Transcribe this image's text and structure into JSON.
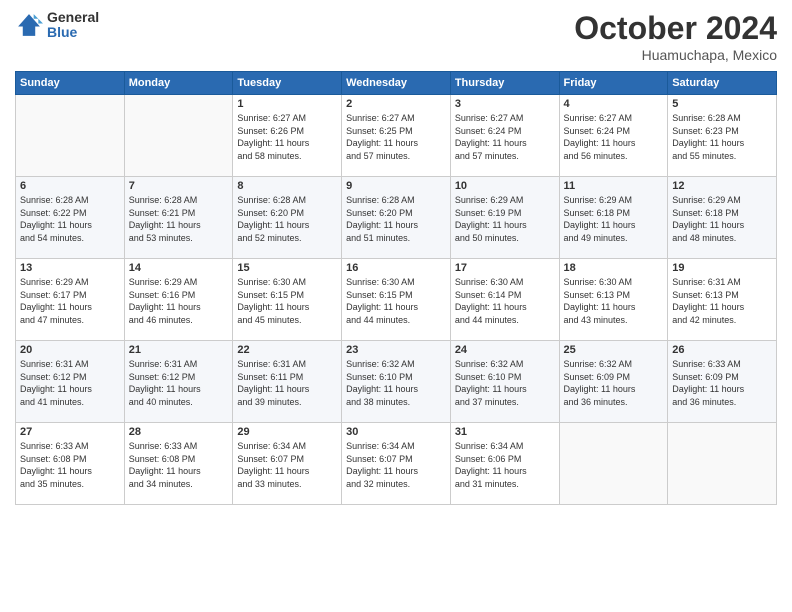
{
  "header": {
    "logo_general": "General",
    "logo_blue": "Blue",
    "month": "October 2024",
    "location": "Huamuchapa, Mexico"
  },
  "days_of_week": [
    "Sunday",
    "Monday",
    "Tuesday",
    "Wednesday",
    "Thursday",
    "Friday",
    "Saturday"
  ],
  "weeks": [
    [
      {
        "day": "",
        "info": ""
      },
      {
        "day": "",
        "info": ""
      },
      {
        "day": "1",
        "info": "Sunrise: 6:27 AM\nSunset: 6:26 PM\nDaylight: 11 hours\nand 58 minutes."
      },
      {
        "day": "2",
        "info": "Sunrise: 6:27 AM\nSunset: 6:25 PM\nDaylight: 11 hours\nand 57 minutes."
      },
      {
        "day": "3",
        "info": "Sunrise: 6:27 AM\nSunset: 6:24 PM\nDaylight: 11 hours\nand 57 minutes."
      },
      {
        "day": "4",
        "info": "Sunrise: 6:27 AM\nSunset: 6:24 PM\nDaylight: 11 hours\nand 56 minutes."
      },
      {
        "day": "5",
        "info": "Sunrise: 6:28 AM\nSunset: 6:23 PM\nDaylight: 11 hours\nand 55 minutes."
      }
    ],
    [
      {
        "day": "6",
        "info": "Sunrise: 6:28 AM\nSunset: 6:22 PM\nDaylight: 11 hours\nand 54 minutes."
      },
      {
        "day": "7",
        "info": "Sunrise: 6:28 AM\nSunset: 6:21 PM\nDaylight: 11 hours\nand 53 minutes."
      },
      {
        "day": "8",
        "info": "Sunrise: 6:28 AM\nSunset: 6:20 PM\nDaylight: 11 hours\nand 52 minutes."
      },
      {
        "day": "9",
        "info": "Sunrise: 6:28 AM\nSunset: 6:20 PM\nDaylight: 11 hours\nand 51 minutes."
      },
      {
        "day": "10",
        "info": "Sunrise: 6:29 AM\nSunset: 6:19 PM\nDaylight: 11 hours\nand 50 minutes."
      },
      {
        "day": "11",
        "info": "Sunrise: 6:29 AM\nSunset: 6:18 PM\nDaylight: 11 hours\nand 49 minutes."
      },
      {
        "day": "12",
        "info": "Sunrise: 6:29 AM\nSunset: 6:18 PM\nDaylight: 11 hours\nand 48 minutes."
      }
    ],
    [
      {
        "day": "13",
        "info": "Sunrise: 6:29 AM\nSunset: 6:17 PM\nDaylight: 11 hours\nand 47 minutes."
      },
      {
        "day": "14",
        "info": "Sunrise: 6:29 AM\nSunset: 6:16 PM\nDaylight: 11 hours\nand 46 minutes."
      },
      {
        "day": "15",
        "info": "Sunrise: 6:30 AM\nSunset: 6:15 PM\nDaylight: 11 hours\nand 45 minutes."
      },
      {
        "day": "16",
        "info": "Sunrise: 6:30 AM\nSunset: 6:15 PM\nDaylight: 11 hours\nand 44 minutes."
      },
      {
        "day": "17",
        "info": "Sunrise: 6:30 AM\nSunset: 6:14 PM\nDaylight: 11 hours\nand 44 minutes."
      },
      {
        "day": "18",
        "info": "Sunrise: 6:30 AM\nSunset: 6:13 PM\nDaylight: 11 hours\nand 43 minutes."
      },
      {
        "day": "19",
        "info": "Sunrise: 6:31 AM\nSunset: 6:13 PM\nDaylight: 11 hours\nand 42 minutes."
      }
    ],
    [
      {
        "day": "20",
        "info": "Sunrise: 6:31 AM\nSunset: 6:12 PM\nDaylight: 11 hours\nand 41 minutes."
      },
      {
        "day": "21",
        "info": "Sunrise: 6:31 AM\nSunset: 6:12 PM\nDaylight: 11 hours\nand 40 minutes."
      },
      {
        "day": "22",
        "info": "Sunrise: 6:31 AM\nSunset: 6:11 PM\nDaylight: 11 hours\nand 39 minutes."
      },
      {
        "day": "23",
        "info": "Sunrise: 6:32 AM\nSunset: 6:10 PM\nDaylight: 11 hours\nand 38 minutes."
      },
      {
        "day": "24",
        "info": "Sunrise: 6:32 AM\nSunset: 6:10 PM\nDaylight: 11 hours\nand 37 minutes."
      },
      {
        "day": "25",
        "info": "Sunrise: 6:32 AM\nSunset: 6:09 PM\nDaylight: 11 hours\nand 36 minutes."
      },
      {
        "day": "26",
        "info": "Sunrise: 6:33 AM\nSunset: 6:09 PM\nDaylight: 11 hours\nand 36 minutes."
      }
    ],
    [
      {
        "day": "27",
        "info": "Sunrise: 6:33 AM\nSunset: 6:08 PM\nDaylight: 11 hours\nand 35 minutes."
      },
      {
        "day": "28",
        "info": "Sunrise: 6:33 AM\nSunset: 6:08 PM\nDaylight: 11 hours\nand 34 minutes."
      },
      {
        "day": "29",
        "info": "Sunrise: 6:34 AM\nSunset: 6:07 PM\nDaylight: 11 hours\nand 33 minutes."
      },
      {
        "day": "30",
        "info": "Sunrise: 6:34 AM\nSunset: 6:07 PM\nDaylight: 11 hours\nand 32 minutes."
      },
      {
        "day": "31",
        "info": "Sunrise: 6:34 AM\nSunset: 6:06 PM\nDaylight: 11 hours\nand 31 minutes."
      },
      {
        "day": "",
        "info": ""
      },
      {
        "day": "",
        "info": ""
      }
    ]
  ]
}
